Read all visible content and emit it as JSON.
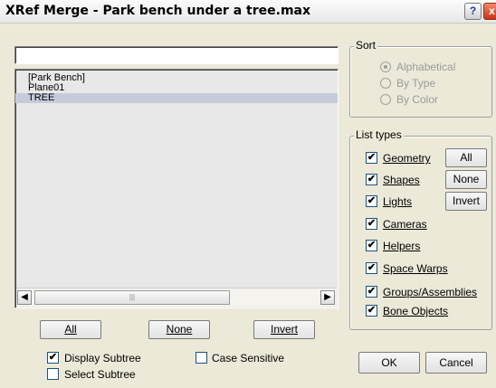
{
  "window": {
    "title": "XRef Merge - Park bench under a tree.max",
    "help_icon": "?",
    "close_icon": "x"
  },
  "filter": {
    "value": ""
  },
  "list": {
    "items": [
      {
        "label": "[Park Bench]",
        "selected": false
      },
      {
        "label": "Plane01",
        "selected": false
      },
      {
        "label": "TREE",
        "selected": true
      }
    ],
    "thumb_grip": "|||"
  },
  "buttons": {
    "all_label": "All",
    "none_label": "None",
    "invert_label": "Invert",
    "ok_label": "OK",
    "cancel_label": "Cancel"
  },
  "options": {
    "display_subtree": {
      "label": "Display Subtree",
      "checked": true
    },
    "case_sensitive": {
      "label": "Case Sensitive",
      "checked": false
    },
    "select_subtree": {
      "label": "Select Subtree",
      "checked": false
    }
  },
  "sort": {
    "title": "Sort",
    "options": [
      {
        "label": "Alphabetical",
        "selected": true
      },
      {
        "label": "By Type",
        "selected": false
      },
      {
        "label": "By Color",
        "selected": false
      }
    ]
  },
  "list_types": {
    "title": "List types",
    "items": [
      {
        "label": "Geometry",
        "checked": true
      },
      {
        "label": "Shapes",
        "checked": true
      },
      {
        "label": "Lights",
        "checked": true
      },
      {
        "label": "Cameras",
        "checked": true
      },
      {
        "label": "Helpers",
        "checked": true
      },
      {
        "label": "Space Warps",
        "checked": true
      },
      {
        "label": "Groups/Assemblies",
        "checked": true
      },
      {
        "label": "Bone Objects",
        "checked": true
      }
    ],
    "all_label": "All",
    "none_label": "None",
    "invert_label": "Invert"
  },
  "check_mark": "✔"
}
